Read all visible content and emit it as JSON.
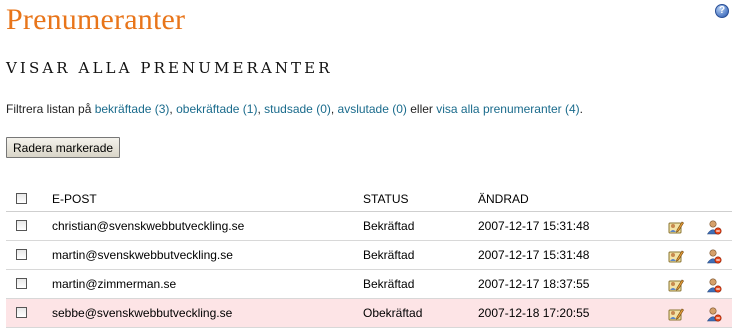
{
  "page": {
    "title": "Prenumeranter",
    "help_icon": "question-icon",
    "section_title": "VISAR ALLA PRENUMERANTER"
  },
  "filter": {
    "prefix": "Filtrera listan på ",
    "confirmed": "bekräftade (3)",
    "sep1": ", ",
    "unconfirmed": "obekräftade (1)",
    "sep2": ", ",
    "bounced": "studsade (0)",
    "sep3": ", ",
    "ended": "avslutade (0)",
    "or": " eller ",
    "all": "visa alla prenumeranter (4)",
    "end": "."
  },
  "actions": {
    "delete_label": "Radera markerade"
  },
  "table": {
    "headers": {
      "email": "E-POST",
      "status": "STATUS",
      "changed": "ÄNDRAD"
    },
    "rows": [
      {
        "email": "christian@svenskwebbutveckling.se",
        "status": "Bekräftad",
        "changed": "2007-12-17 15:31:48"
      },
      {
        "email": "martin@svenskwebbutveckling.se",
        "status": "Bekräftad",
        "changed": "2007-12-17 15:31:48"
      },
      {
        "email": "martin@zimmerman.se",
        "status": "Bekräftad",
        "changed": "2007-12-17 18:37:55"
      },
      {
        "email": "sebbe@svenskwebbutveckling.se",
        "status": "Obekräftad",
        "changed": "2007-12-18 17:20:55"
      }
    ]
  },
  "colors": {
    "title": "#e8751a",
    "link": "#1a6b8c",
    "unconfirmed_row": "#fde4e6"
  }
}
